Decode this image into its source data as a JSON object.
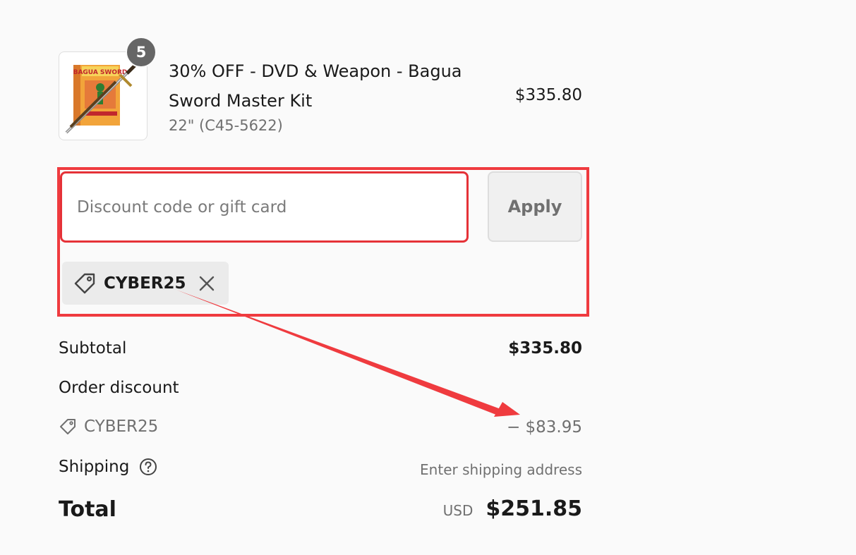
{
  "product": {
    "title": "30% OFF - DVD & Weapon - Bagua Sword Master Kit",
    "variant": "22\" (C45-5622)",
    "price": "$335.80",
    "quantity": "5",
    "image_text": "BAGUA SWORD"
  },
  "discount": {
    "input_placeholder": "Discount code or gift card",
    "input_value": "",
    "apply_label": "Apply",
    "applied_code": "CYBER25"
  },
  "summary": {
    "subtotal_label": "Subtotal",
    "subtotal_value": "$335.80",
    "order_discount_label": "Order discount",
    "discount_code": "CYBER25",
    "discount_amount": "− $83.95",
    "shipping_label": "Shipping",
    "shipping_value": "Enter shipping address",
    "total_label": "Total",
    "total_currency": "USD",
    "total_value": "$251.85"
  },
  "icons": {
    "tag": "tag-icon",
    "remove": "close-icon",
    "help": "question-circle-icon"
  },
  "colors": {
    "annotation_red": "#ef3b3f",
    "input_border_red": "#e53238",
    "muted_text": "#707070",
    "badge_bg": "#666666",
    "chip_bg": "#ebebeb"
  }
}
